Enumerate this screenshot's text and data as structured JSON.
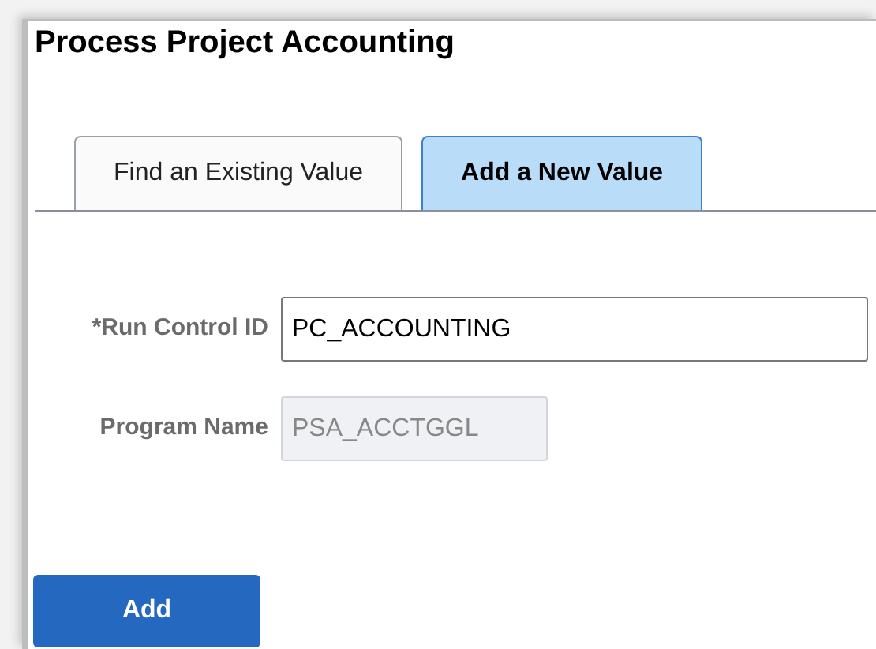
{
  "page": {
    "title": "Process Project Accounting"
  },
  "tabs": [
    {
      "label": "Find an Existing Value",
      "selected": false
    },
    {
      "label": "Add a New Value",
      "selected": true
    }
  ],
  "fields": [
    {
      "label": "*Run Control ID",
      "value": "PC_ACCOUNTING",
      "disabled": false
    },
    {
      "label": "Program Name",
      "value": "PSA_ACCTGGL",
      "disabled": true
    }
  ],
  "buttons": [
    "Add"
  ]
}
